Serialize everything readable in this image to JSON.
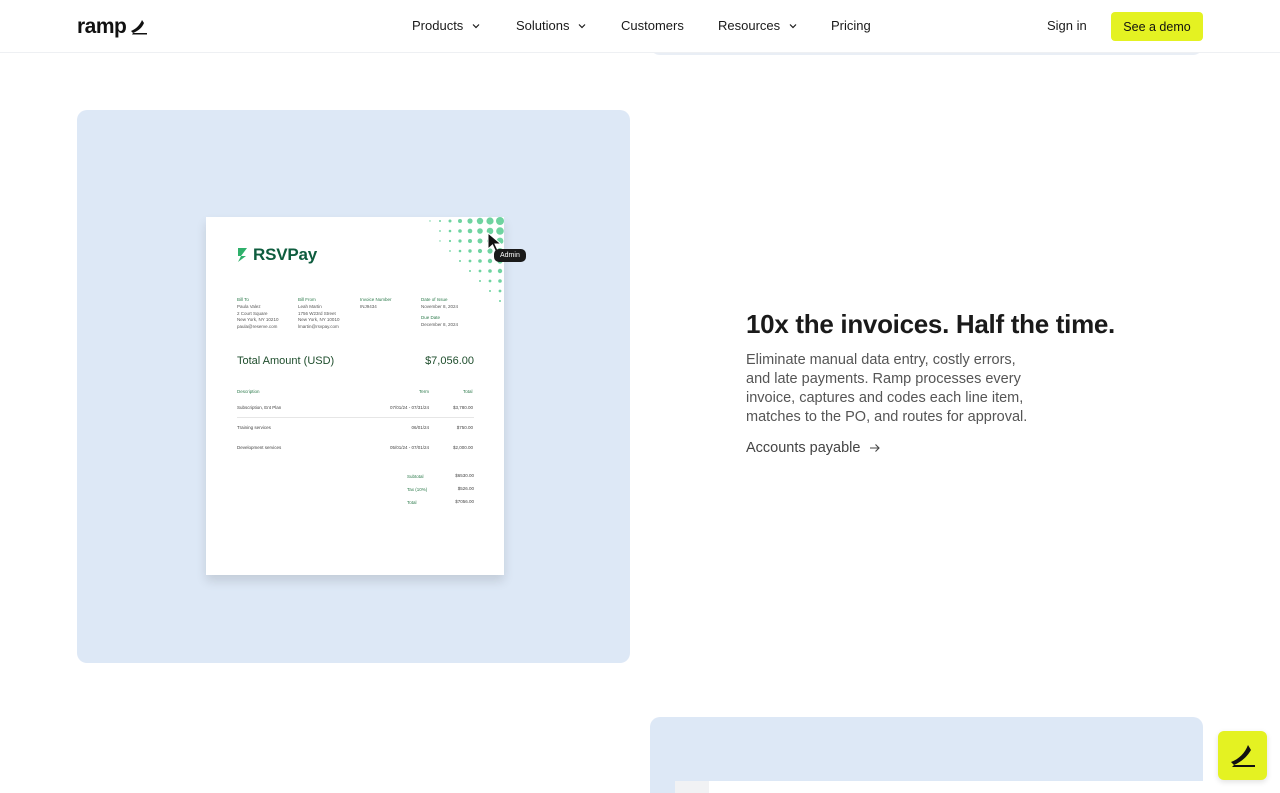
{
  "nav": {
    "logo_text": "ramp",
    "items": [
      {
        "label": "Products",
        "has_dropdown": true
      },
      {
        "label": "Solutions",
        "has_dropdown": true
      },
      {
        "label": "Customers",
        "has_dropdown": false
      },
      {
        "label": "Resources",
        "has_dropdown": true
      },
      {
        "label": "Pricing",
        "has_dropdown": false
      }
    ],
    "sign_in": "Sign in",
    "cta": "See a demo"
  },
  "colors": {
    "accent": "#e4f222",
    "card_bg": "#dde8f6",
    "brand_green": "#0e5c3e"
  },
  "feature": {
    "headline": "10x the invoices. Half the time.",
    "description": "Eliminate manual data entry, costly errors, and late payments. Ramp processes every invoice, captures and codes each line item, matches to the PO, and routes for approval.",
    "link_label": "Accounts payable",
    "link_icon": "arrow-right-icon"
  },
  "invoice": {
    "brand": "RSVPay",
    "admin_tag": "Admin",
    "bill_to_label": "Bill To",
    "bill_to": "Paula Valez\n2 Court Square\nNew York, NY 10210\npaula@reserve.com",
    "bill_from_label": "Bill From",
    "bill_from": "Leah Martin\n1756 W23rd Street\nNew York, NY 10010\nlmartin@rsvpay.com",
    "invoice_number_label": "Invoice Number",
    "invoice_number": "INJ9434",
    "issue_label": "Date of Issue",
    "issue_date": "November 8, 2024",
    "due_label": "Due Date",
    "due_date": "December 8, 2024",
    "total_label": "Total Amount (USD)",
    "total_value": "$7,056.00",
    "columns": {
      "description": "Description",
      "term": "Term",
      "total": "Total"
    },
    "rows": [
      {
        "description": "Subscription, Ent Plan",
        "term": "07/01/24 - 07/31/24",
        "total": "$3,780.00"
      },
      {
        "description": "Training services",
        "term": "06/01/24",
        "total": "$750.00"
      },
      {
        "description": "Development services",
        "term": "05/01/24 - 07/01/24",
        "total": "$2,000.00"
      }
    ],
    "summary": [
      {
        "label": "Subtotal",
        "value": "$6530.00"
      },
      {
        "label": "Tax (10%)",
        "value": "$526.00"
      },
      {
        "label": "Total",
        "value": "$7056.00"
      }
    ]
  }
}
